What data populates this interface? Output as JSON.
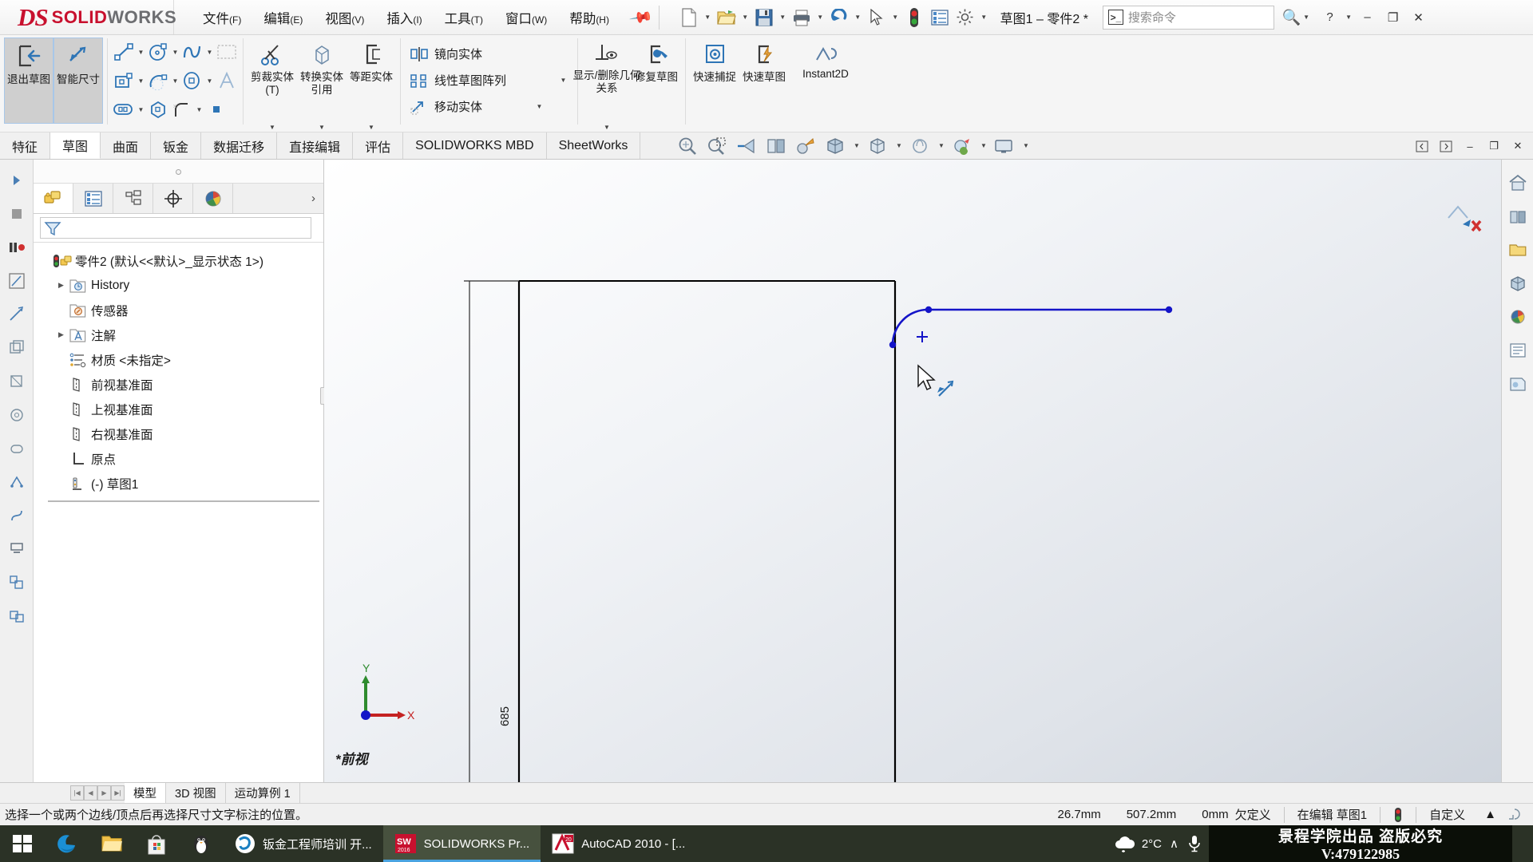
{
  "titlebar": {
    "logo_ds": "DS",
    "logo_solid": "SOLID",
    "logo_works": "WORKS",
    "menus": [
      {
        "label": "文件",
        "key": "(F)"
      },
      {
        "label": "编辑",
        "key": "(E)"
      },
      {
        "label": "视图",
        "key": "(V)"
      },
      {
        "label": "插入",
        "key": "(I)"
      },
      {
        "label": "工具",
        "key": "(T)"
      },
      {
        "label": "窗口",
        "key": "(W)"
      },
      {
        "label": "帮助",
        "key": "(H)"
      }
    ],
    "pin_icon": "pushpin-icon",
    "quick_access": [
      "new-document-icon",
      "open-folder-icon",
      "save-icon",
      "print-icon",
      "undo-icon",
      "select-cursor-icon",
      "rebuild-status-icon",
      "options-list-icon",
      "settings-gear-icon"
    ],
    "document_title": "草图1 – 零件2 *",
    "search_placeholder": "搜索命令",
    "search_prefix_icon": "command-search-icon",
    "search_magnifier_icon": "magnifier-icon",
    "help_label": "?",
    "window_minimize": "–",
    "window_restore": "❐",
    "window_close": "✕"
  },
  "ribbon": {
    "exit_sketch": "退出草图",
    "smart_dimension": "智能尺寸",
    "sketch_entities": [
      "line-icon",
      "rectangle-icon",
      "circle-icon",
      "arc-icon",
      "spline-icon",
      "ellipse-icon",
      "sketch-fillet-icon",
      "text-icon",
      "slot-icon",
      "polygon-icon",
      "point-icon",
      "plane-icon"
    ],
    "trim_entities": "剪裁实体(T)",
    "convert_entities": "转换实体引用",
    "offset_entities": "等距实体",
    "mirror_entities": "镜向实体",
    "linear_sketch_pattern": "线性草图阵列",
    "move_entities": "移动实体",
    "display_delete_relations": "显示/删除几何关系",
    "repair_sketch": "修复草图",
    "quick_snaps": "快速捕捉",
    "quick_sketch": "快速草图",
    "instant2d": "Instant2D"
  },
  "tabs": {
    "items": [
      {
        "label": "特征",
        "active": false
      },
      {
        "label": "草图",
        "active": true
      },
      {
        "label": "曲面",
        "active": false
      },
      {
        "label": "钣金",
        "active": false
      },
      {
        "label": "数据迁移",
        "active": false
      },
      {
        "label": "直接编辑",
        "active": false
      },
      {
        "label": "评估",
        "active": false
      },
      {
        "label": "SOLIDWORKS MBD",
        "active": false
      },
      {
        "label": "SheetWorks",
        "active": false
      }
    ],
    "view_tools": [
      "zoom-to-fit-icon",
      "zoom-to-area-icon",
      "previous-view-icon",
      "section-view-icon",
      "view-orientation-icon",
      "display-style-icon",
      "hide-show-items-icon",
      "edit-appearance-icon",
      "apply-scene-icon",
      "view-settings-icon"
    ],
    "window_controls": [
      "restore-pane-left-icon",
      "restore-pane-right-icon",
      "minimize-doc",
      "restore-doc",
      "close-doc"
    ]
  },
  "tree": {
    "left_strip_icons": [
      "expand-arrow-icon",
      "stop-icon",
      "pause-icon",
      "sketch-tool-icon",
      "dimension-tool-icon",
      "entity-icon-1",
      "entity-icon-2",
      "entity-icon-3",
      "entity-icon-4",
      "entity-icon-5",
      "entity-icon-6",
      "entity-icon-7",
      "relation-icon-1",
      "relation-icon-2",
      "relation-icon-3",
      "pattern-icon-1",
      "pattern-icon-2"
    ],
    "panel_tabs": [
      {
        "name": "feature-manager-tab",
        "icon": "yellow-blocks-icon",
        "active": true
      },
      {
        "name": "property-manager-tab",
        "icon": "property-list-icon",
        "active": false
      },
      {
        "name": "configuration-manager-tab",
        "icon": "configuration-icon",
        "active": false
      },
      {
        "name": "dimxpert-manager-tab",
        "icon": "dimxpert-crosshair-icon",
        "active": false
      },
      {
        "name": "display-manager-tab",
        "icon": "display-sphere-icon",
        "active": false
      }
    ],
    "more_chevron": "›",
    "filter_icon": "filter-funnel-icon",
    "filter_value": "",
    "root": "零件2  (默认<<默认>_显示状态 1>)",
    "root_icon": "part-status-icon",
    "items": [
      {
        "label": "History",
        "icon": "history-folder-icon",
        "twisty": "▶",
        "indent": 0
      },
      {
        "label": "传感器",
        "icon": "sensor-folder-icon",
        "twisty": "",
        "indent": 0
      },
      {
        "label": "注解",
        "icon": "annotations-folder-icon",
        "twisty": "▶",
        "indent": 0
      },
      {
        "label": "材质 <未指定>",
        "icon": "material-icon",
        "twisty": "",
        "indent": 0
      },
      {
        "label": "前视基准面",
        "icon": "plane-icon",
        "twisty": "",
        "indent": 0
      },
      {
        "label": "上视基准面",
        "icon": "plane-icon",
        "twisty": "",
        "indent": 0
      },
      {
        "label": "右视基准面",
        "icon": "plane-icon",
        "twisty": "",
        "indent": 0
      },
      {
        "label": "原点",
        "icon": "origin-icon",
        "twisty": "",
        "indent": 0
      },
      {
        "label": "(-) 草图1",
        "icon": "sketch-icon",
        "twisty": "",
        "indent": 0
      }
    ]
  },
  "canvas": {
    "dimension_label": "685",
    "view_label": "*前视",
    "triad_x": "X",
    "triad_y": "Y",
    "cursor_icon": "arrow-cursor-icon",
    "dimension_cursor_icon": "smart-dimension-cursor-icon",
    "geometry": {
      "sketch_color": "#1414c8",
      "model_color": "#000000",
      "description": "Rectangle outline with filleted top-right corner and blue sketch line"
    }
  },
  "rail": {
    "icons": [
      "view-home-icon",
      "prior-view-icon",
      "view-folder-icon",
      "view-orientation-box-icon",
      "appearance-sphere-icon",
      "scene-list-icon",
      "decal-icon"
    ],
    "close_mark": "✕"
  },
  "doc_tabs": {
    "nav": [
      "|◀",
      "◀",
      "▶",
      "▶|"
    ],
    "items": [
      {
        "label": "模型",
        "active": true
      },
      {
        "label": "3D 视图",
        "active": false
      },
      {
        "label": "运动算例 1",
        "active": false
      }
    ]
  },
  "statusbar": {
    "message": "选择一个或两个边线/顶点后再选择尺寸文字标注的位置。",
    "coord_x": "26.7mm",
    "coord_y": "507.2mm",
    "coord_z": "0mm",
    "state": "欠定义",
    "editing": "在编辑 草图1",
    "rebuild_icon": "rebuild-status-icon",
    "customize": "自定义",
    "customize_caret": "▲",
    "corner_icon": "resize-grip-icon"
  },
  "taskbar": {
    "start_icon": "windows-start-icon",
    "pinned": [
      "edge-browser-icon",
      "file-explorer-icon",
      "microsoft-store-icon",
      "qq-penguin-icon"
    ],
    "apps": [
      {
        "label": "钣金工程师培训 开...",
        "icon": "browser-app-icon",
        "active": false
      },
      {
        "label": "SOLIDWORKS Pr...",
        "icon": "solidworks-app-icon",
        "active": true
      },
      {
        "label": "AutoCAD 2010 - [...",
        "icon": "autocad-app-icon",
        "active": false
      }
    ],
    "tray": {
      "weather_icon": "cloud-icon",
      "temperature": "2°C",
      "chevron": "∧",
      "mic_icon": "microphone-icon"
    },
    "watermark_line1": "景程学院出品 盗版必究",
    "watermark_line2": "V:479122985"
  },
  "colors": {
    "brand_red": "#c8102e",
    "sketch_blue": "#1414c8",
    "taskbar_bg": "#2b3226",
    "accent_blue": "#2e75b6"
  }
}
